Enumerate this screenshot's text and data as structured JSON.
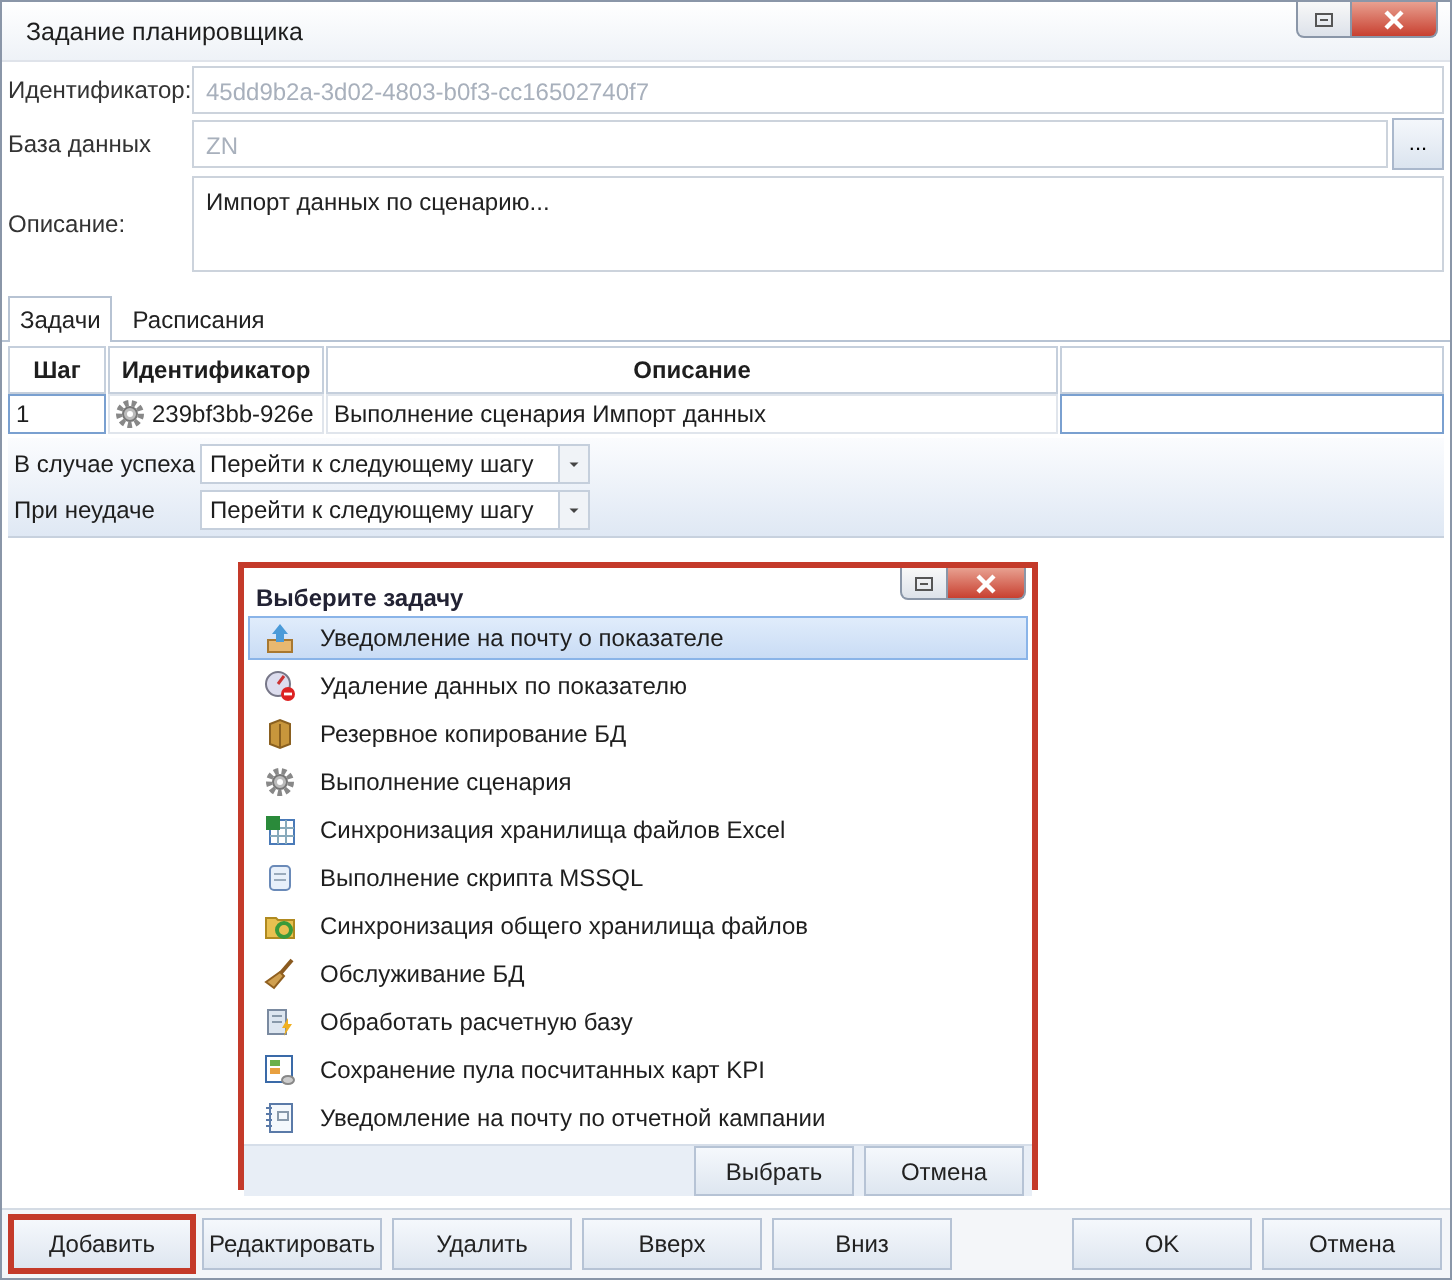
{
  "window": {
    "title": "Задание планировщика"
  },
  "fields": [
    {
      "kind": "text",
      "label": "Идентификатор:",
      "value": "45dd9b2a-3d02-4803-b0f3-cc16502740f7",
      "disabled": true
    },
    {
      "kind": "browse",
      "label": "База данных",
      "value": "ZN",
      "disabled": true,
      "button": "..."
    },
    {
      "kind": "memo",
      "label": "Описание:",
      "value": "Импорт данных по сценарию...",
      "disabled": false
    }
  ],
  "tabs": [
    {
      "label": "Задачи",
      "selected": true
    },
    {
      "label": "Расписания",
      "selected": false
    }
  ],
  "table": {
    "columns": [
      "Шаг",
      "Идентификатор",
      "Описание"
    ],
    "rows": [
      {
        "step": "1",
        "id": "239bf3bb-926e",
        "description": "Выполнение сценария Импорт данных"
      }
    ]
  },
  "actions": [
    {
      "label": "В случае успеха",
      "value": "Перейти к следующему шагу"
    },
    {
      "label": "При неудаче",
      "value": "Перейти к следующему шагу"
    }
  ],
  "dialog": {
    "title": "Выберите задачу",
    "highlighted": true,
    "items": [
      {
        "kind": "upload",
        "label": "Уведомление на почту о показателе",
        "selected": true
      },
      {
        "kind": "gauge",
        "label": "Удаление данных по показателю",
        "selected": false
      },
      {
        "kind": "box",
        "label": "Резервное копирование БД",
        "selected": false
      },
      {
        "kind": "gear",
        "label": "Выполнение сценария",
        "selected": false
      },
      {
        "kind": "sheet",
        "label": "Синхронизация хранилища файлов Excel",
        "selected": false
      },
      {
        "kind": "scroll",
        "label": "Выполнение скрипта MSSQL",
        "selected": false
      },
      {
        "kind": "folder",
        "label": "Синхронизация общего хранилища файлов",
        "selected": false
      },
      {
        "kind": "broom",
        "label": "Обслуживание БД",
        "selected": false
      },
      {
        "kind": "bolt",
        "label": "Обработать расчетную базу",
        "selected": false
      },
      {
        "kind": "grid",
        "label": "Сохранение пула посчитанных карт KPI",
        "selected": false
      },
      {
        "kind": "notebook",
        "label": "Уведомление на почту по отчетной кампании",
        "selected": false
      }
    ],
    "buttons": [
      "Выбрать",
      "Отмена"
    ]
  },
  "edit_buttons": [
    {
      "label": "Добавить",
      "highlighted": true
    },
    {
      "label": "Редактировать",
      "highlighted": false
    },
    {
      "label": "Удалить",
      "highlighted": false
    },
    {
      "label": "Вверх",
      "highlighted": false
    },
    {
      "label": "Вниз",
      "highlighted": false
    }
  ],
  "dialog_buttons": [
    {
      "label": "OK",
      "highlighted": false
    },
    {
      "label": "Отмена",
      "highlighted": false
    }
  ]
}
